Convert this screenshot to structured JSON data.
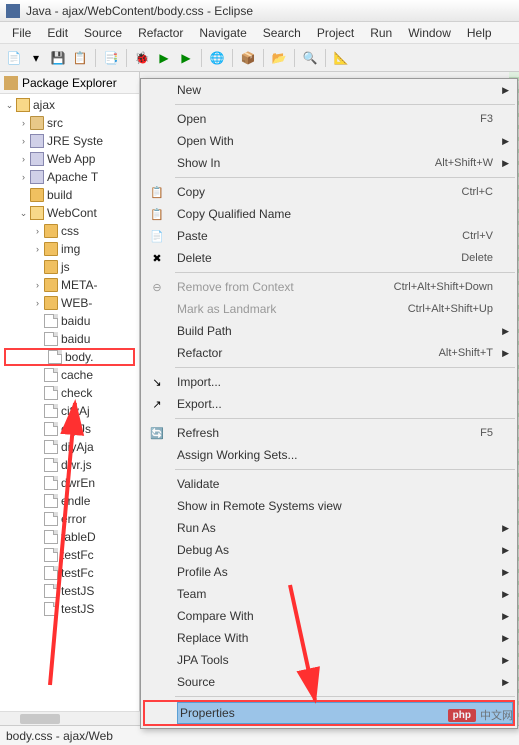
{
  "window": {
    "title": "Java - ajax/WebContent/body.css - Eclipse"
  },
  "menubar": [
    "File",
    "Edit",
    "Source",
    "Refactor",
    "Navigate",
    "Search",
    "Project",
    "Run",
    "Window",
    "Help"
  ],
  "explorer": {
    "title": "Package Explorer",
    "project": "ajax",
    "nodes": {
      "src": "src",
      "jre": "JRE Syste",
      "webapp": "Web App",
      "apache": "Apache T",
      "build": "build",
      "webcontent": "WebCont",
      "css": "css",
      "img": "img",
      "js": "js",
      "meta": "META-",
      "webinf": "WEB-",
      "baidu1": "baidu",
      "baidu2": "baidu",
      "body": "body.",
      "cache": "cache",
      "check": "check",
      "cityajax": "cityAj",
      "cityjs": "cityJs",
      "diyaja": "diyAja",
      "dwrjs": "dwr.js",
      "dwren": "dwrEn",
      "endle": "endle",
      "error": "error",
      "tabled": "tableD",
      "testfc1": "testFc",
      "testfc2": "testFc",
      "testjs1": "testJS",
      "testjs2": "testJS"
    }
  },
  "context_menu": [
    {
      "label": "New",
      "submenu": true
    },
    {
      "sep": true
    },
    {
      "label": "Open",
      "shortcut": "F3"
    },
    {
      "label": "Open With",
      "submenu": true
    },
    {
      "label": "Show In",
      "shortcut": "Alt+Shift+W",
      "submenu": true
    },
    {
      "sep": true
    },
    {
      "label": "Copy",
      "shortcut": "Ctrl+C",
      "icon": "copy"
    },
    {
      "label": "Copy Qualified Name",
      "icon": "copy-q"
    },
    {
      "label": "Paste",
      "shortcut": "Ctrl+V",
      "icon": "paste"
    },
    {
      "label": "Delete",
      "shortcut": "Delete",
      "icon": "delete"
    },
    {
      "sep": true
    },
    {
      "label": "Remove from Context",
      "shortcut": "Ctrl+Alt+Shift+Down",
      "disabled": true,
      "icon": "remove"
    },
    {
      "label": "Mark as Landmark",
      "shortcut": "Ctrl+Alt+Shift+Up",
      "disabled": true
    },
    {
      "label": "Build Path",
      "submenu": true
    },
    {
      "label": "Refactor",
      "shortcut": "Alt+Shift+T",
      "submenu": true
    },
    {
      "sep": true
    },
    {
      "label": "Import...",
      "icon": "import"
    },
    {
      "label": "Export...",
      "icon": "export"
    },
    {
      "sep": true
    },
    {
      "label": "Refresh",
      "shortcut": "F5",
      "icon": "refresh"
    },
    {
      "label": "Assign Working Sets..."
    },
    {
      "sep": true
    },
    {
      "label": "Validate"
    },
    {
      "label": "Show in Remote Systems view"
    },
    {
      "label": "Run As",
      "submenu": true
    },
    {
      "label": "Debug As",
      "submenu": true
    },
    {
      "label": "Profile As",
      "submenu": true
    },
    {
      "label": "Team",
      "submenu": true
    },
    {
      "label": "Compare With",
      "submenu": true
    },
    {
      "label": "Replace With",
      "submenu": true
    },
    {
      "label": "JPA Tools",
      "submenu": true
    },
    {
      "label": "Source",
      "submenu": true
    },
    {
      "sep": true
    },
    {
      "label": "Properties",
      "highlighted": true
    }
  ],
  "statusbar": {
    "breadcrumb": "body.css - ajax/Web"
  },
  "watermark": {
    "badge": "php",
    "text": "中文网"
  }
}
